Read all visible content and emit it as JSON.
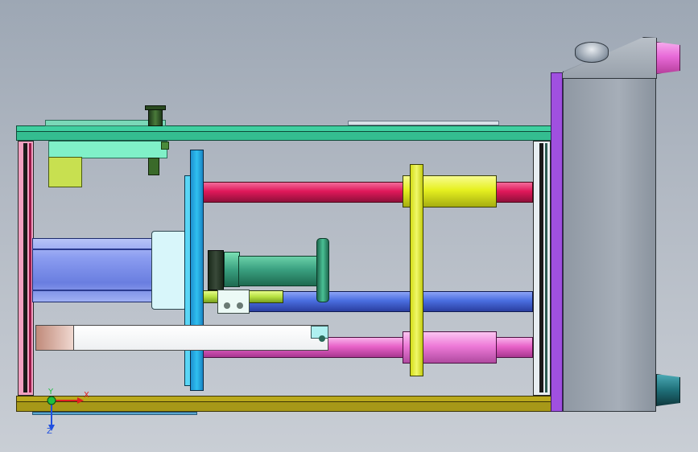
{
  "viewport": {
    "background_top": "#9da7b4",
    "background_bottom": "#c9ced5"
  },
  "colors": {
    "frame_rail": "#3fcfa0",
    "bottom_rail": "#b9a81c",
    "cabinet": "#8f98a3",
    "cabinet_frame": "#a050e0",
    "red_rod": "#e0185a",
    "blue_rod": "#4a6ee0",
    "pink_rod": "#e862c8",
    "yellow_bushing": "#e6f020",
    "cyan_plate": "#2fc0f0",
    "blue_cylinder": "#8a9cf0",
    "green_tube": "#3aa080",
    "magenta_nozzle": "#e86ad8",
    "teal_nozzle": "#1f6f78"
  },
  "triad": {
    "x_label": "X",
    "y_label": "Y",
    "z_label": "Z",
    "x_color": "#e02020",
    "y_color": "#20c040",
    "z_color": "#2050e0"
  }
}
